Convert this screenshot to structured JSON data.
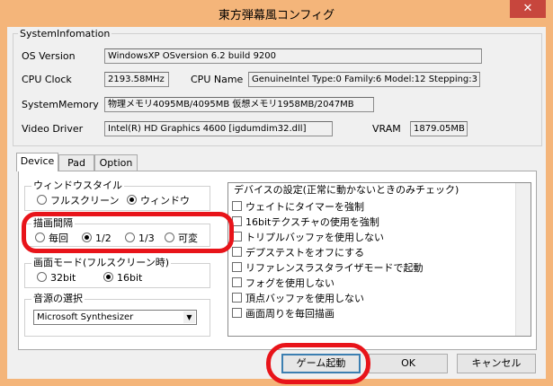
{
  "window": {
    "title": "東方弾幕風コンフィグ",
    "close_glyph": "✕"
  },
  "sysinfo": {
    "legend": "SystemInfomation",
    "os_label": "OS Version",
    "os_value": "WindowsXP OSversion 6.2  build 9200",
    "cpu_clock_label": "CPU Clock",
    "cpu_clock_value": "2193.58MHz",
    "cpu_name_label": "CPU Name",
    "cpu_name_value": "GenuineIntel  Type:0 Family:6 Model:12 Stepping:3",
    "memory_label": "SystemMemory",
    "memory_value": "物理メモリ4095MB/4095MB  仮想メモリ1958MB/2047MB",
    "video_label": "Video Driver",
    "video_value": "Intel(R) HD Graphics 4600 [igdumdim32.dll]",
    "vram_label": "VRAM",
    "vram_value": "1879.05MB"
  },
  "tabs": [
    {
      "label": "Device",
      "active": true
    },
    {
      "label": "Pad",
      "active": false
    },
    {
      "label": "Option",
      "active": false
    }
  ],
  "window_style": {
    "legend": "ウィンドウスタイル",
    "options": [
      {
        "label": "フルスクリーン",
        "selected": false
      },
      {
        "label": "ウィンドウ",
        "selected": true
      }
    ]
  },
  "draw_interval": {
    "legend": "描画間隔",
    "options": [
      {
        "label": "毎回",
        "selected": false
      },
      {
        "label": "1/2",
        "selected": true
      },
      {
        "label": "1/3",
        "selected": false
      },
      {
        "label": "可変",
        "selected": false
      }
    ]
  },
  "screen_mode": {
    "legend": "画面モード(フルスクリーン時)",
    "options": [
      {
        "label": "32bit",
        "selected": false
      },
      {
        "label": "16bit",
        "selected": true
      }
    ]
  },
  "sound_source": {
    "legend": "音源の選択",
    "selected": "Microsoft Synthesizer",
    "arrow_glyph": "▼"
  },
  "device_settings": {
    "header": "デバイスの設定(正常に動かないときのみチェック)",
    "items": [
      {
        "label": "ウェイトにタイマーを強制",
        "checked": false
      },
      {
        "label": "16bitテクスチャの使用を強制",
        "checked": false
      },
      {
        "label": "トリプルバッファを使用しない",
        "checked": false
      },
      {
        "label": "デプステストをオフにする",
        "checked": false
      },
      {
        "label": "リファレンスラスタライザモードで起動",
        "checked": false
      },
      {
        "label": "フォグを使用しない",
        "checked": false
      },
      {
        "label": "頂点バッファを使用しない",
        "checked": false
      },
      {
        "label": "画面周りを毎回描画",
        "checked": false
      }
    ]
  },
  "buttons": {
    "launch": "ゲーム起動",
    "ok": "OK",
    "cancel": "キャンセル"
  },
  "colors": {
    "title_bar": "#f4b57a",
    "close_button": "#c7463d",
    "annotation": "#e8141a",
    "default_button_border": "#3c7fb1"
  }
}
